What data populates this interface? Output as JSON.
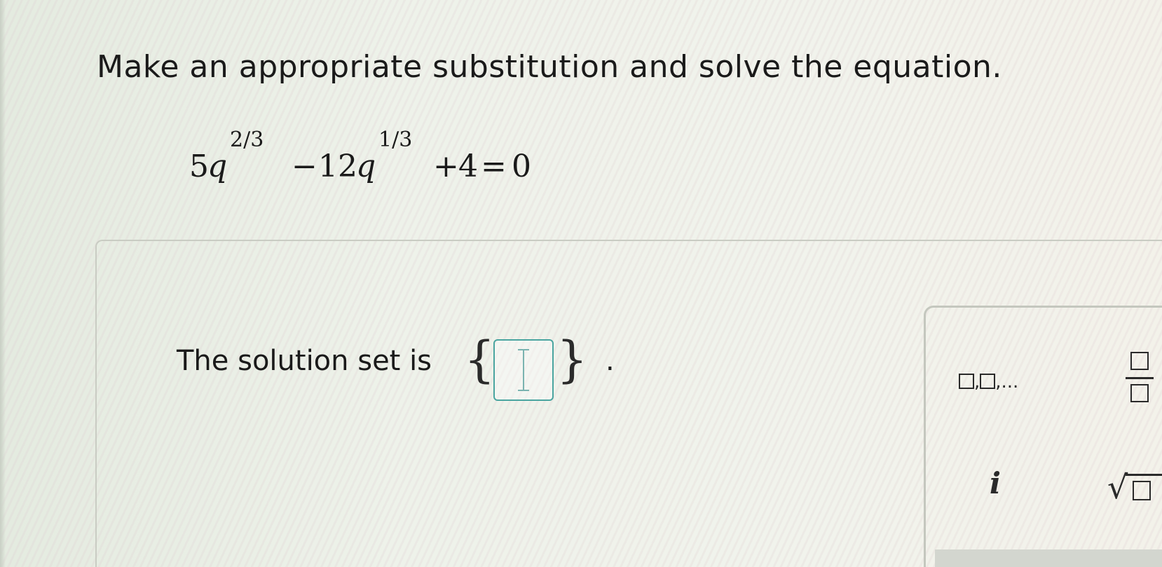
{
  "question": {
    "instruction": "Make an appropriate substitution and solve the equation."
  },
  "equation": {
    "coef1": "5",
    "var1": "q",
    "exp1": "2/3",
    "op1": "−",
    "coef2": "12",
    "var2": "q",
    "exp2": "1/3",
    "op2": "+",
    "const": "4",
    "eq": "=",
    "rhs": "0"
  },
  "answer": {
    "prefix": "The solution set is",
    "open_brace": "{",
    "close_brace": "}",
    "value": "",
    "suffix": "."
  },
  "math_palette": {
    "list_separator": ",",
    "list_ellipsis": ",...",
    "imaginary_label": "i",
    "sqrt_symbol": "√",
    "icons": [
      "list-icon",
      "fraction-icon",
      "imaginary-unit-icon",
      "square-root-icon"
    ]
  }
}
